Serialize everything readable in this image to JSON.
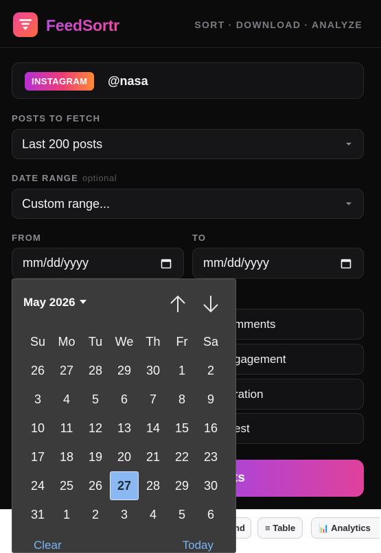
{
  "header": {
    "brand": "FeedSortr",
    "tagline": "SORT · DOWNLOAD · ANALYZE",
    "logo_icon": "funnel-lines-icon",
    "accent_gradient": [
      "#f0439a",
      "#ff6a3d"
    ]
  },
  "account": {
    "platform": "INSTAGRAM",
    "handle": "@nasa"
  },
  "posts_to_fetch": {
    "label": "POSTS TO FETCH",
    "value": "Last 200 posts"
  },
  "date_range": {
    "label": "DATE RANGE",
    "optional": "optional",
    "value": "Custom range..."
  },
  "from": {
    "label": "FROM",
    "placeholder": "mm/dd/yyyy"
  },
  "to": {
    "label": "TO",
    "placeholder": "mm/dd/yyyy"
  },
  "sort_options": [
    {
      "label": "mments"
    },
    {
      "label": "gagement"
    },
    {
      "label": "ration"
    },
    {
      "label": "est"
    }
  ],
  "cta": {
    "label": "ts"
  },
  "bottom_tabs": [
    {
      "label": "nd",
      "icon": ""
    },
    {
      "label": "Table",
      "icon": "≡"
    },
    {
      "label": "Analytics",
      "icon": "📊"
    }
  ],
  "picker": {
    "month": "May 2026",
    "weekdays": [
      "Su",
      "Mo",
      "Tu",
      "We",
      "Th",
      "Fr",
      "Sa"
    ],
    "days": [
      [
        "26",
        "27",
        "28",
        "29",
        "30",
        "1",
        "2"
      ],
      [
        "3",
        "4",
        "5",
        "6",
        "7",
        "8",
        "9"
      ],
      [
        "10",
        "11",
        "12",
        "13",
        "14",
        "15",
        "16"
      ],
      [
        "17",
        "18",
        "19",
        "20",
        "21",
        "22",
        "23"
      ],
      [
        "24",
        "25",
        "26",
        "27",
        "28",
        "29",
        "30"
      ],
      [
        "31",
        "1",
        "2",
        "3",
        "4",
        "5",
        "6"
      ]
    ],
    "selected": "27",
    "clear": "Clear",
    "today": "Today",
    "selected_color": "#8ab8f2"
  }
}
